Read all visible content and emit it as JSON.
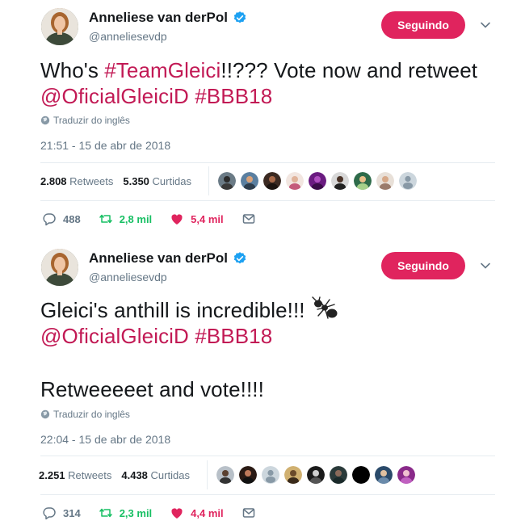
{
  "tweets": [
    {
      "name": "Anneliese van derPol",
      "handle": "@anneliesevdp",
      "follow_label": "Seguindo",
      "text_part1": "Who's ",
      "hashtag1": "#TeamGleici",
      "text_part2": "!!??? Vote now and retweet",
      "mention": "@OficialGleiciD",
      "hashtag2": "#BBB18",
      "translate": "Traduzir do inglês",
      "timestamp": "21:51 - 15 de abr de 2018",
      "retweets_value": "2.808",
      "retweets_label": "Retweets",
      "likes_value": "5.350",
      "likes_label": "Curtidas",
      "reply_count": "488",
      "retweet_count": "2,8 mil",
      "like_count": "5,4 mil"
    },
    {
      "name": "Anneliese van derPol",
      "handle": "@anneliesevdp",
      "follow_label": "Seguindo",
      "text_line1": "Gleici's anthill is incredible!!! ",
      "mention": "@OficialGleiciD",
      "hashtag": "#BBB18",
      "text_line3": "Retweeeeet and vote!!!!",
      "translate": "Traduzir do inglês",
      "timestamp": "22:04 - 15 de abr de 2018",
      "retweets_value": "2.251",
      "retweets_label": "Retweets",
      "likes_value": "4.438",
      "likes_label": "Curtidas",
      "reply_count": "314",
      "retweet_count": "2,3 mil",
      "like_count": "4,4 mil"
    }
  ],
  "colors": {
    "link": "#c21a55",
    "follow_button": "#e0245e",
    "verified": "#1da1f2",
    "retweet": "#17bf63",
    "like": "#e0245e",
    "muted": "#657786"
  },
  "icons": [
    "verified-badge-icon",
    "chevron-down-icon",
    "globe-icon",
    "reply-icon",
    "retweet-icon",
    "heart-icon",
    "message-icon",
    "ant-emoji"
  ]
}
